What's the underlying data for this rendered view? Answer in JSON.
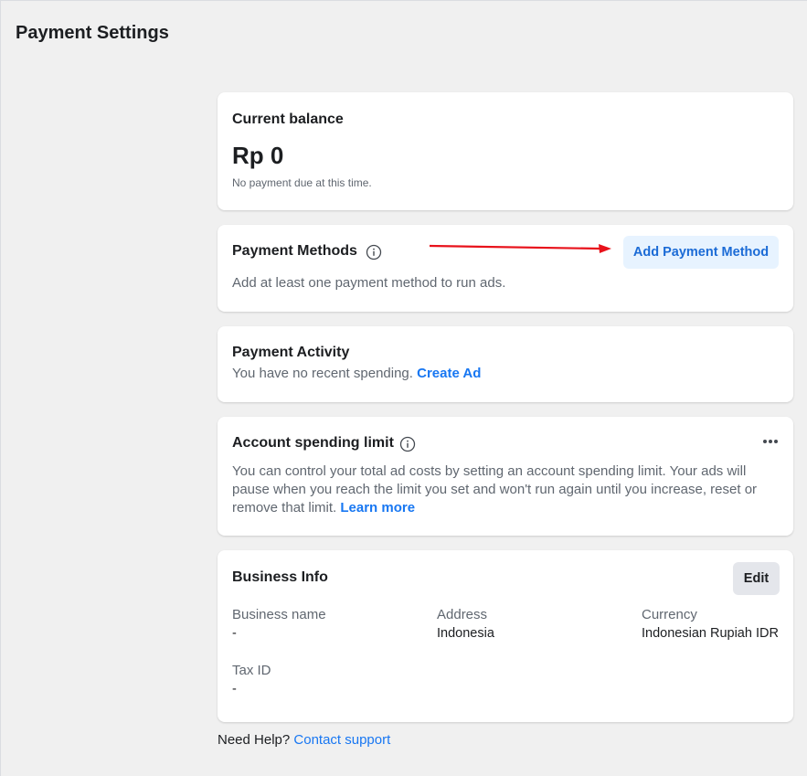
{
  "page": {
    "title": "Payment Settings"
  },
  "balance": {
    "title": "Current balance",
    "amount": "Rp 0",
    "note": "No payment due at this time."
  },
  "payment_methods": {
    "title": "Payment Methods",
    "info_icon": "info-icon",
    "add_button": "Add Payment Method",
    "description": "Add at least one payment method to run ads."
  },
  "payment_activity": {
    "title": "Payment Activity",
    "description": "You have no recent spending.",
    "link": "Create Ad"
  },
  "spending_limit": {
    "title": "Account spending limit",
    "info_icon": "info-icon",
    "more_icon": "more-horizontal-icon",
    "description": "You can control your total ad costs by setting an account spending limit. Your ads will pause when you reach the limit you set and won't run again until you increase, reset or remove that limit.",
    "link": "Learn more"
  },
  "business_info": {
    "title": "Business Info",
    "edit_button": "Edit",
    "fields": [
      {
        "label": "Business name",
        "value": "-"
      },
      {
        "label": "Address",
        "value": "Indonesia"
      },
      {
        "label": "Currency",
        "value": "Indonesian Rupiah IDR"
      },
      {
        "label": "Tax ID",
        "value": "-"
      }
    ]
  },
  "help": {
    "text": "Need Help?",
    "link": "Contact support"
  },
  "colors": {
    "background": "#f0f0f0",
    "card": "#ffffff",
    "accent": "#1877f2",
    "primary_button_bg": "#e7f3ff",
    "secondary_button_bg": "#e4e6eb",
    "annotation_arrow": "#e8121b"
  }
}
